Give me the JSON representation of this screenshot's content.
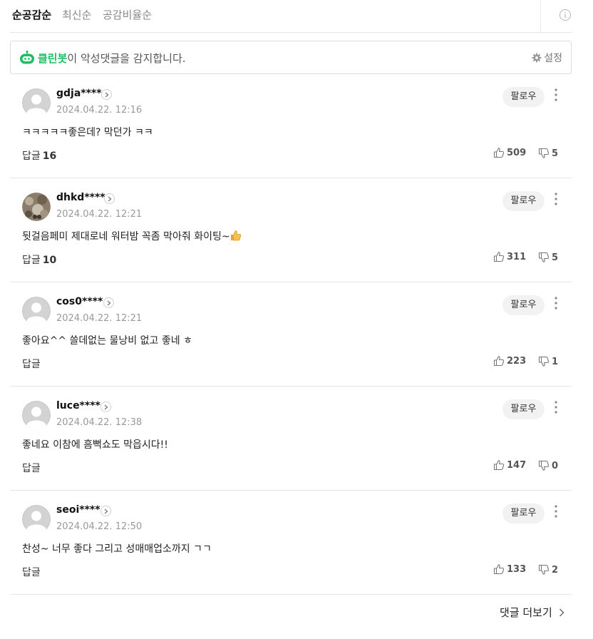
{
  "sort": {
    "tabs": [
      {
        "label": "순공감순",
        "active": true
      },
      {
        "label": "최신순",
        "active": false
      },
      {
        "label": "공감비율순",
        "active": false
      }
    ]
  },
  "cleanbot": {
    "brand": "클린봇",
    "message": "이 악성댓글을 감지합니다.",
    "settings_label": "설정",
    "brand_color": "#1bbf63"
  },
  "comments": [
    {
      "nickname": "gdja****",
      "date": "2024.04.22. 12:16",
      "text": "ㅋㅋㅋㅋㅋ좋은데? 막던가 ㅋㅋ",
      "reply_label": "답글",
      "reply_count": "16",
      "likes": "509",
      "dislikes": "5",
      "follow_label": "팔로우",
      "avatar": "default"
    },
    {
      "nickname": "dhkd****",
      "date": "2024.04.22. 12:21",
      "text": "뒷걸음페미 제대로네 워터밤 꼭좀 막아줘 화이팅~",
      "reply_label": "답글",
      "reply_count": "10",
      "likes": "311",
      "dislikes": "5",
      "follow_label": "팔로우",
      "avatar": "photo",
      "emoji": "thumbs-up"
    },
    {
      "nickname": "cos0****",
      "date": "2024.04.22. 12:21",
      "text": "좋아요^^ 쓸데없는 물낭비 없고 좋네 ㅎ",
      "reply_label": "답글",
      "reply_count": "",
      "likes": "223",
      "dislikes": "1",
      "follow_label": "팔로우",
      "avatar": "default"
    },
    {
      "nickname": "luce****",
      "date": "2024.04.22. 12:38",
      "text": "좋네요 이참에 흠뻑쇼도 막읍시다!!",
      "reply_label": "답글",
      "reply_count": "",
      "likes": "147",
      "dislikes": "0",
      "follow_label": "팔로우",
      "avatar": "default"
    },
    {
      "nickname": "seoi****",
      "date": "2024.04.22. 12:50",
      "text": "찬성~ 너무 좋다 그리고 성매매업소까지 ㄱㄱ",
      "reply_label": "답글",
      "reply_count": "",
      "likes": "133",
      "dislikes": "2",
      "follow_label": "팔로우",
      "avatar": "default"
    }
  ],
  "more_comments_label": "댓글 더보기"
}
